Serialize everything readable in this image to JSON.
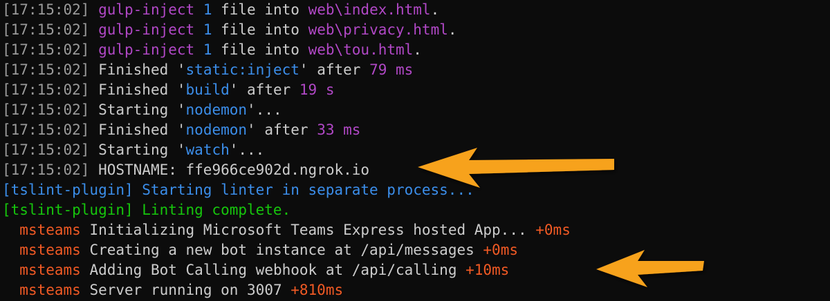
{
  "colors": {
    "background": "#0c0c0c",
    "timestamp": "#9a9a9a",
    "text": "#cccccc",
    "magenta": "#b148c6",
    "blue": "#3b8eea",
    "green": "#16c60c",
    "orange": "#f15a24",
    "arrow": "#f7a21b"
  },
  "lines": [
    {
      "ts": "[17:15:02]",
      "parts": [
        {
          "t": "gulp-inject",
          "c": "purple"
        },
        {
          "t": " ",
          "c": "white"
        },
        {
          "t": "1",
          "c": "blue"
        },
        {
          "t": " file into ",
          "c": "white"
        },
        {
          "t": "web\\index.html",
          "c": "purple"
        },
        {
          "t": ".",
          "c": "white"
        }
      ]
    },
    {
      "ts": "[17:15:02]",
      "parts": [
        {
          "t": "gulp-inject",
          "c": "purple"
        },
        {
          "t": " ",
          "c": "white"
        },
        {
          "t": "1",
          "c": "blue"
        },
        {
          "t": " file into ",
          "c": "white"
        },
        {
          "t": "web\\privacy.html",
          "c": "purple"
        },
        {
          "t": ".",
          "c": "white"
        }
      ]
    },
    {
      "ts": "[17:15:02]",
      "parts": [
        {
          "t": "gulp-inject",
          "c": "purple"
        },
        {
          "t": " ",
          "c": "white"
        },
        {
          "t": "1",
          "c": "blue"
        },
        {
          "t": " file into ",
          "c": "white"
        },
        {
          "t": "web\\tou.html",
          "c": "purple"
        },
        {
          "t": ".",
          "c": "white"
        }
      ]
    },
    {
      "ts": "[17:15:02]",
      "parts": [
        {
          "t": "Finished '",
          "c": "white"
        },
        {
          "t": "static:inject",
          "c": "cyan"
        },
        {
          "t": "' after ",
          "c": "white"
        },
        {
          "t": "79 ms",
          "c": "purple"
        }
      ]
    },
    {
      "ts": "[17:15:02]",
      "parts": [
        {
          "t": "Finished '",
          "c": "white"
        },
        {
          "t": "build",
          "c": "cyan"
        },
        {
          "t": "' after ",
          "c": "white"
        },
        {
          "t": "19 s",
          "c": "purple"
        }
      ]
    },
    {
      "ts": "[17:15:02]",
      "parts": [
        {
          "t": "Starting '",
          "c": "white"
        },
        {
          "t": "nodemon",
          "c": "cyan"
        },
        {
          "t": "'...",
          "c": "white"
        }
      ]
    },
    {
      "ts": "[17:15:02]",
      "parts": [
        {
          "t": "Finished '",
          "c": "white"
        },
        {
          "t": "nodemon",
          "c": "cyan"
        },
        {
          "t": "' after ",
          "c": "white"
        },
        {
          "t": "33 ms",
          "c": "purple"
        }
      ]
    },
    {
      "ts": "[17:15:02]",
      "parts": [
        {
          "t": "Starting '",
          "c": "white"
        },
        {
          "t": "watch",
          "c": "cyan"
        },
        {
          "t": "'...",
          "c": "white"
        }
      ]
    },
    {
      "ts": "[17:15:02]",
      "parts": [
        {
          "t": "HOSTNAME: ffe966ce902d.ngrok.io",
          "c": "white"
        }
      ]
    },
    {
      "ts": "",
      "parts": [
        {
          "t": "[tslint-plugin] Starting linter in separate process...",
          "c": "blue"
        }
      ]
    },
    {
      "ts": "",
      "parts": [
        {
          "t": "[tslint-plugin] Linting complete.",
          "c": "green"
        }
      ]
    },
    {
      "ts": "",
      "parts": [
        {
          "t": "  ",
          "c": "white"
        },
        {
          "t": "msteams",
          "c": "orange"
        },
        {
          "t": " Initializing Microsoft Teams Express hosted App... ",
          "c": "white"
        },
        {
          "t": "+0ms",
          "c": "orange"
        }
      ]
    },
    {
      "ts": "",
      "parts": [
        {
          "t": "  ",
          "c": "white"
        },
        {
          "t": "msteams",
          "c": "orange"
        },
        {
          "t": " Creating a new bot instance at /api/messages ",
          "c": "white"
        },
        {
          "t": "+0ms",
          "c": "orange"
        }
      ]
    },
    {
      "ts": "",
      "parts": [
        {
          "t": "  ",
          "c": "white"
        },
        {
          "t": "msteams",
          "c": "orange"
        },
        {
          "t": " Adding Bot Calling webhook at /api/calling ",
          "c": "white"
        },
        {
          "t": "+10ms",
          "c": "orange"
        }
      ]
    },
    {
      "ts": "",
      "parts": [
        {
          "t": "  ",
          "c": "white"
        },
        {
          "t": "msteams",
          "c": "orange"
        },
        {
          "t": " Server running on 3007 ",
          "c": "white"
        },
        {
          "t": "+810ms",
          "c": "orange"
        }
      ]
    }
  ],
  "arrows": [
    {
      "name": "hostname-pointer-arrow-icon"
    },
    {
      "name": "calling-webhook-pointer-arrow-icon"
    }
  ]
}
